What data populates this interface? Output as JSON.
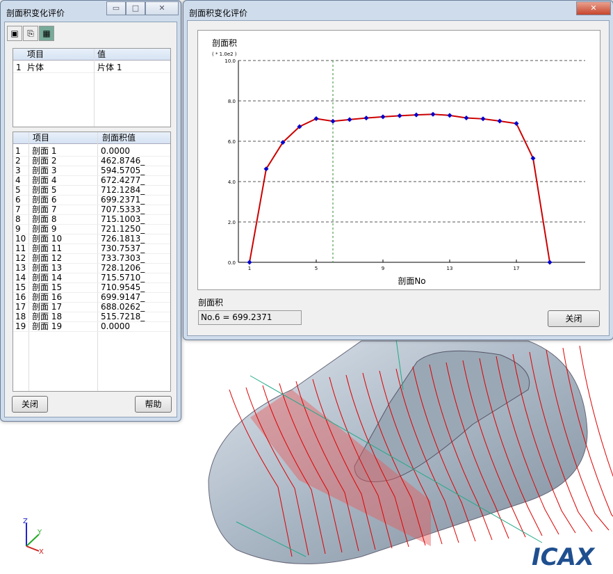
{
  "left_window": {
    "title": "剖面积变化评价",
    "toolbar": [
      "save-icon",
      "copy-icon",
      "export-icon"
    ],
    "top_table": {
      "headers": [
        "项目",
        "值"
      ],
      "rows": [
        [
          "1",
          "片体",
          "片体 1"
        ]
      ]
    },
    "bottom_table": {
      "headers": [
        "项目",
        "剖面积值"
      ],
      "rows": [
        [
          "1",
          "剖面 1",
          "0.0000"
        ],
        [
          "2",
          "剖面 2",
          "462.8746_"
        ],
        [
          "3",
          "剖面 3",
          "594.5705_"
        ],
        [
          "4",
          "剖面 4",
          "672.4277_"
        ],
        [
          "5",
          "剖面 5",
          "712.1284_"
        ],
        [
          "6",
          "剖面 6",
          "699.2371_"
        ],
        [
          "7",
          "剖面 7",
          "707.5333_"
        ],
        [
          "8",
          "剖面 8",
          "715.1003_"
        ],
        [
          "9",
          "剖面 9",
          "721.1250_"
        ],
        [
          "10",
          "剖面 10",
          "726.1813_"
        ],
        [
          "11",
          "剖面 11",
          "730.7537_"
        ],
        [
          "12",
          "剖面 12",
          "733.7303_"
        ],
        [
          "13",
          "剖面 13",
          "728.1206_"
        ],
        [
          "14",
          "剖面 14",
          "715.5710_"
        ],
        [
          "15",
          "剖面 15",
          "710.9545_"
        ],
        [
          "16",
          "剖面 16",
          "699.9147_"
        ],
        [
          "17",
          "剖面 17",
          "688.0262_"
        ],
        [
          "18",
          "剖面 18",
          "515.7218_"
        ],
        [
          "19",
          "剖面 19",
          "0.0000"
        ]
      ]
    },
    "close_label": "关闭",
    "help_label": "帮助"
  },
  "right_window": {
    "title": "剖面积变化评价",
    "section_label": "剖面积",
    "readout": "No.6 = 699.2371",
    "close_label": "关闭"
  },
  "chart_data": {
    "type": "line",
    "title": "剖面积",
    "scale_note": "( * 1.0e2 )",
    "xlabel": "剖面No",
    "ylabel": "剖面积",
    "x": [
      1,
      2,
      3,
      4,
      5,
      6,
      7,
      8,
      9,
      10,
      11,
      12,
      13,
      14,
      15,
      16,
      17,
      18,
      19
    ],
    "values": [
      0,
      4.629,
      5.946,
      6.724,
      7.121,
      6.992,
      7.075,
      7.151,
      7.211,
      7.262,
      7.308,
      7.337,
      7.281,
      7.156,
      7.11,
      6.999,
      6.88,
      5.157,
      0
    ],
    "ylim": [
      0,
      10
    ],
    "yticks": [
      "0.0",
      "2.0",
      "4.0",
      "6.0",
      "8.0",
      "10.0"
    ],
    "xticks": [
      "1",
      "5",
      "9",
      "13",
      "17"
    ],
    "selected_x": 6,
    "grid": true,
    "line_color": "#cc0000",
    "marker_color": "#0000cc"
  },
  "watermark": "ICAX"
}
